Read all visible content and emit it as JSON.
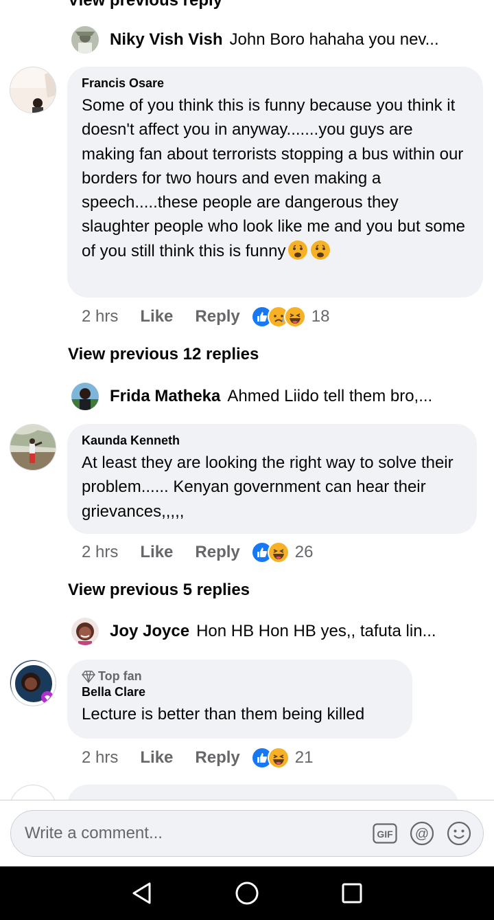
{
  "thread": {
    "top_view_previous": "View previous reply",
    "reply1": {
      "name": "Niky Vish Vish",
      "text": "John Boro hahaha you nev..."
    },
    "comment1": {
      "author": "Francis Osare",
      "body": "Some of you think this is funny because you think it doesn't affect you in anyway.......you guys are making fan about terrorists stopping a bus within our borders for two hours and even making a speech.....these people are dangerous they slaughter people who look like me and you but some of you still think this is funny",
      "time": "2 hrs",
      "like": "Like",
      "reply": "Reply",
      "reaction_count": "18",
      "reaction_icons": [
        "like-icon",
        "sad-icon",
        "haha-icon"
      ]
    },
    "view_previous_2": "View previous 12 replies",
    "reply2": {
      "name": "Frida Matheka",
      "text": "Ahmed Liido tell them bro,..."
    },
    "comment2": {
      "author": "Kaunda Kenneth",
      "body": "At least they are looking the right way to  solve their problem...... Kenyan government can hear their grievances,,,,,",
      "time": "2 hrs",
      "like": "Like",
      "reply": "Reply",
      "reaction_count": "26",
      "reaction_icons": [
        "like-icon",
        "haha-icon"
      ]
    },
    "view_previous_3": "View previous 5 replies",
    "reply3": {
      "name": "Joy Joyce",
      "text": "Hon HB Hon HB yes,, tafuta lin..."
    },
    "comment3": {
      "badge": "Top fan",
      "author": "Bella Clare",
      "body": "Lecture is better than them being killed",
      "time": "2 hrs",
      "like": "Like",
      "reply": "Reply",
      "reaction_count": "21",
      "reaction_icons": [
        "like-icon",
        "haha-icon"
      ]
    }
  },
  "composer": {
    "placeholder": "Write a comment...",
    "icons": [
      "gif-icon",
      "mention-icon",
      "emoji-icon"
    ]
  },
  "navbar": {
    "icons": [
      "back-icon",
      "home-icon",
      "recents-icon"
    ]
  },
  "colors": {
    "like_blue": "#1877f2",
    "haha_yellow": "#f7b125",
    "bubble_gray": "#f0f2f5",
    "meta_gray": "#65676b"
  }
}
